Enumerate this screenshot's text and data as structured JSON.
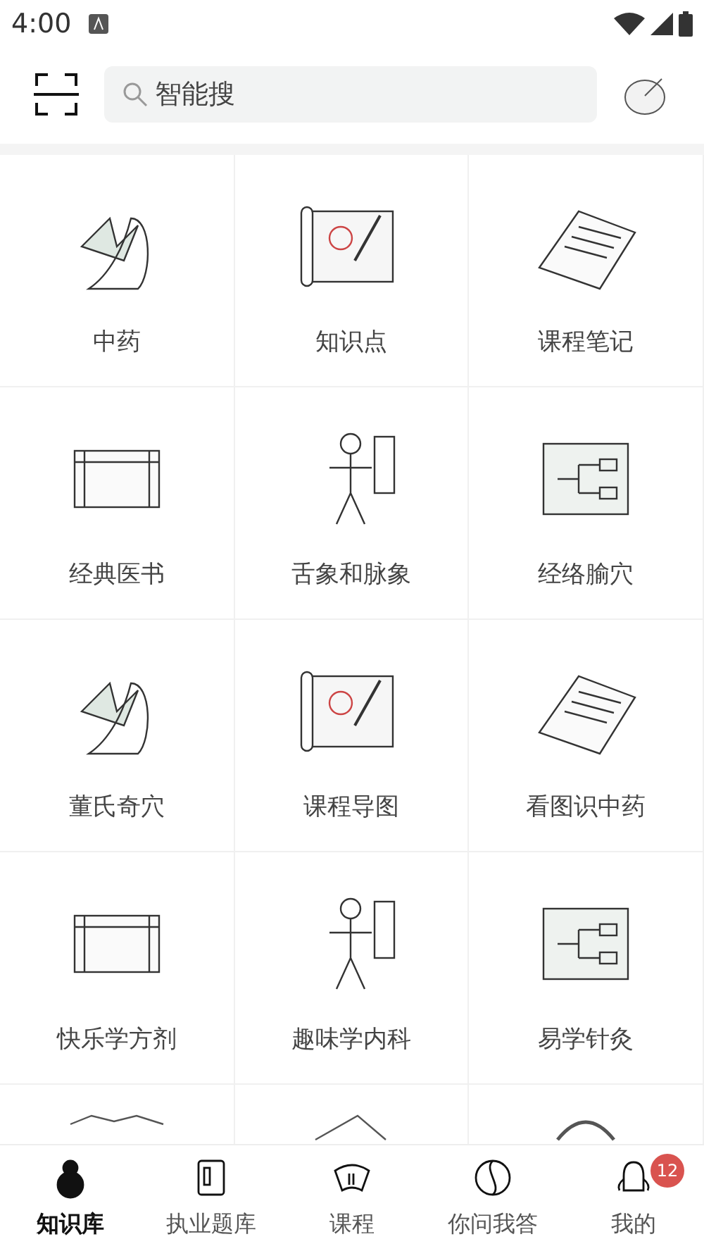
{
  "status_bar": {
    "time": "4:00"
  },
  "search": {
    "placeholder": "智能搜"
  },
  "grid": [
    {
      "label": "中药"
    },
    {
      "label": "知识点"
    },
    {
      "label": "课程笔记"
    },
    {
      "label": "经典医书"
    },
    {
      "label": "舌象和脉象"
    },
    {
      "label": "经络腧穴"
    },
    {
      "label": "董氏奇穴"
    },
    {
      "label": "课程导图"
    },
    {
      "label": "看图识中药"
    },
    {
      "label": "快乐学方剂"
    },
    {
      "label": "趣味学内科"
    },
    {
      "label": "易学针灸"
    }
  ],
  "bottom_nav": [
    {
      "label": "知识库",
      "selected": true
    },
    {
      "label": "执业题库",
      "selected": false
    },
    {
      "label": "课程",
      "selected": false
    },
    {
      "label": "你问我答",
      "selected": false
    },
    {
      "label": "我的",
      "selected": false,
      "badge": "12"
    }
  ]
}
